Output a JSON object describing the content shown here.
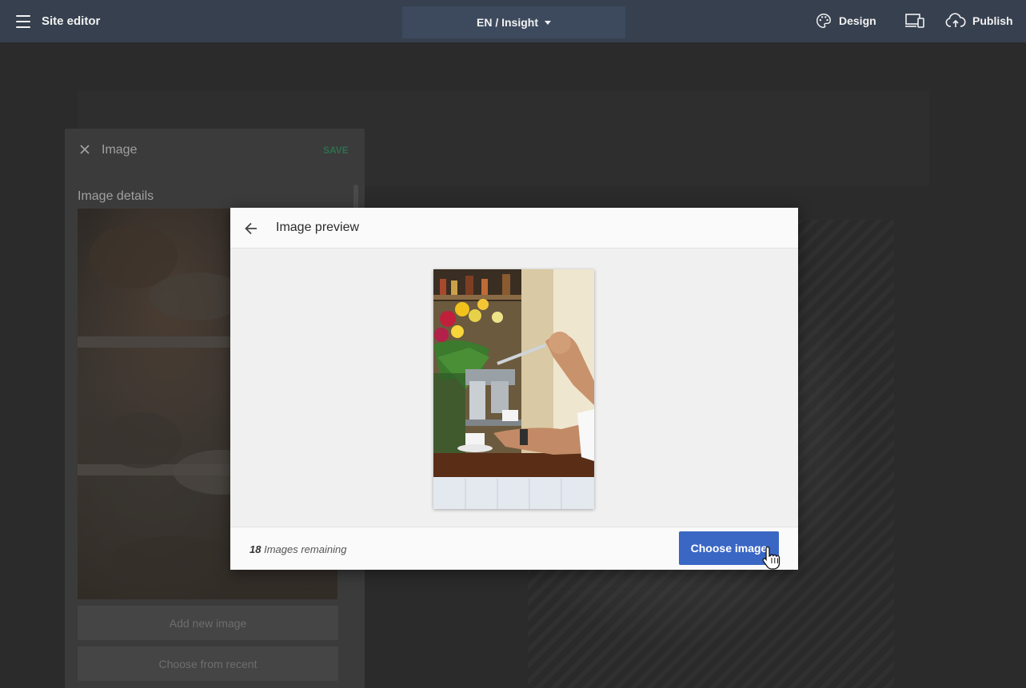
{
  "topbar": {
    "title": "Site editor",
    "language_selector": "EN / Insight",
    "design_label": "Design",
    "publish_label": "Publish"
  },
  "panel": {
    "title": "Image",
    "save_label": "SAVE",
    "section_title": "Image details",
    "add_new_label": "Add new image",
    "choose_recent_label": "Choose from recent"
  },
  "modal": {
    "title": "Image preview",
    "remaining_count": "18",
    "remaining_label": "Images remaining",
    "choose_label": "Choose image"
  },
  "icons": {
    "menu": "menu-icon",
    "design": "palette-icon",
    "devices": "devices-icon",
    "publish": "cloud-upload-icon",
    "close": "close-icon",
    "back": "arrow-back-icon",
    "cursor": "hand-pointer-icon"
  },
  "colors": {
    "topbar": "#36404f",
    "primary_button": "#3a67c4",
    "save_text": "#2f6e4f"
  }
}
